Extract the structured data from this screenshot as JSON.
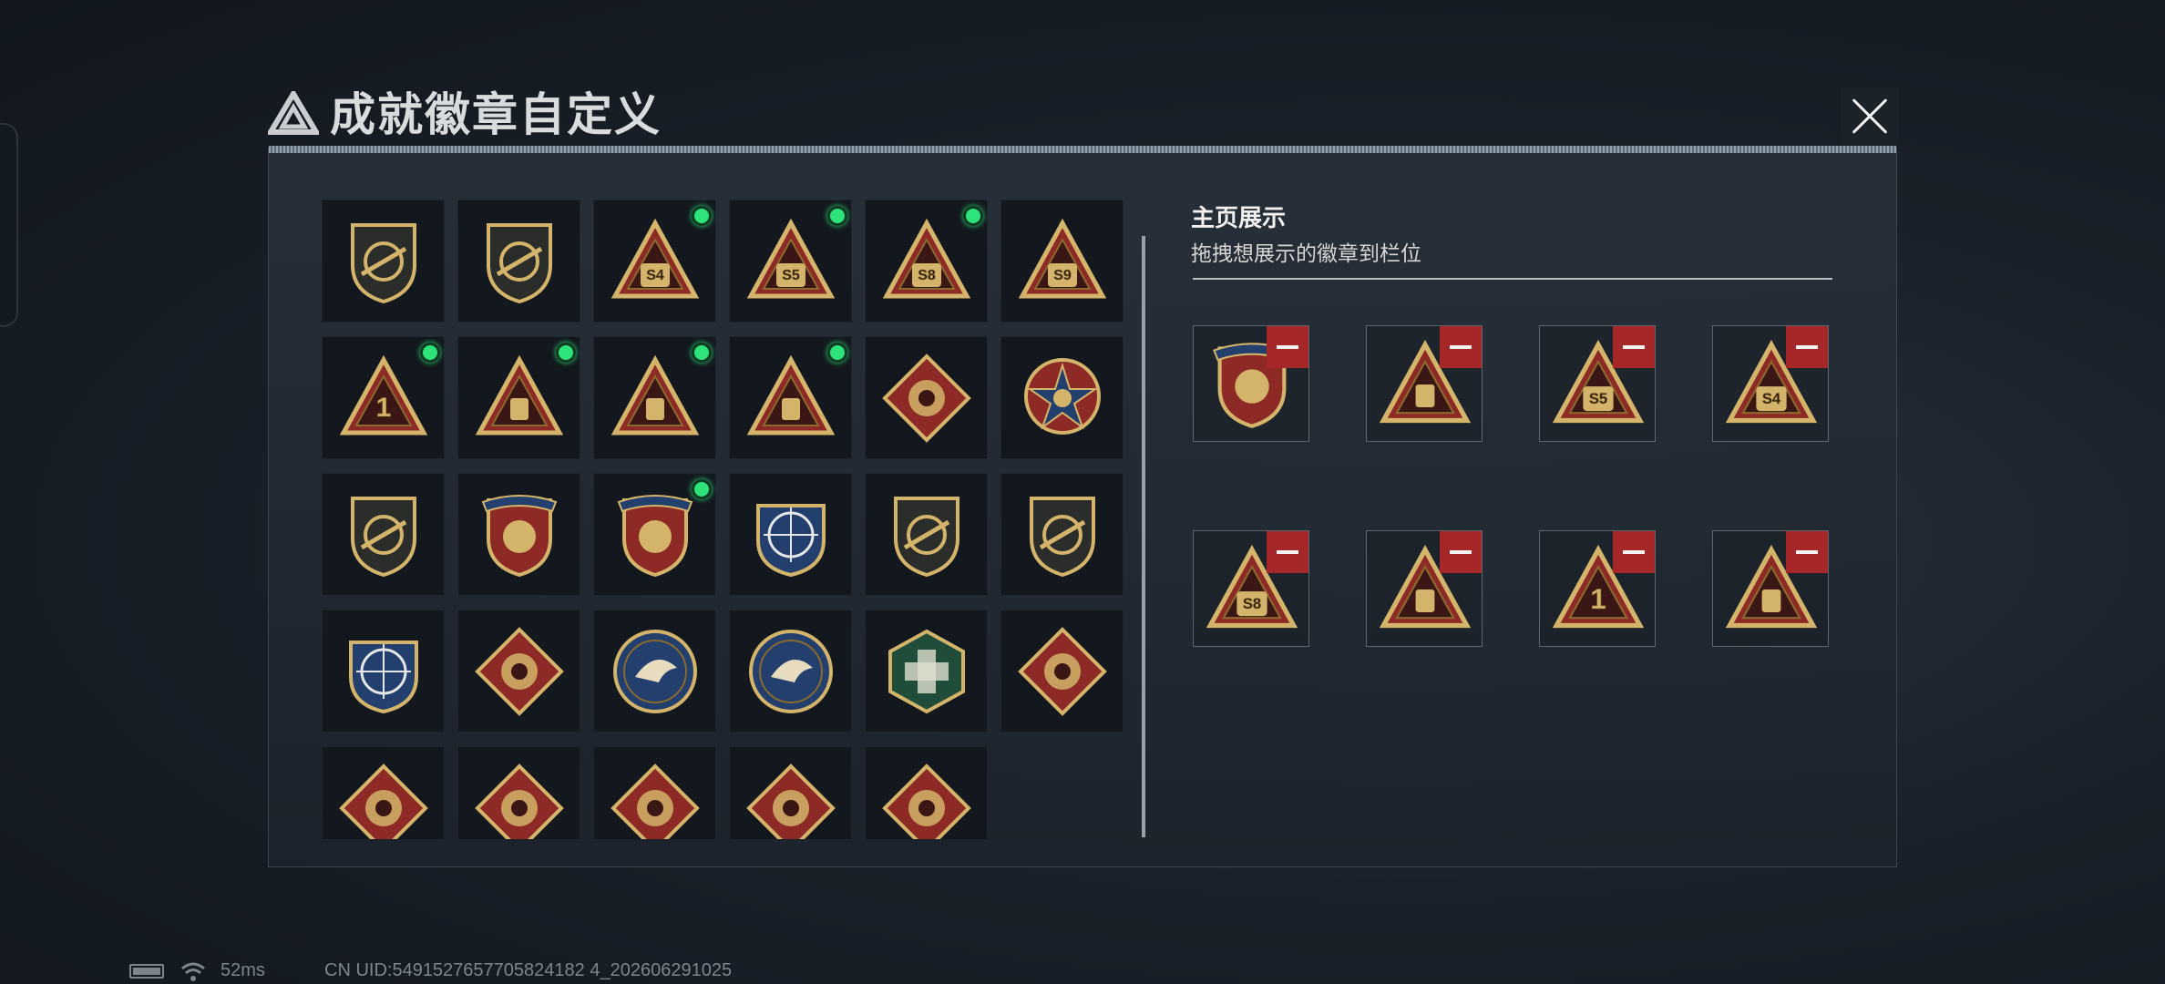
{
  "window": {
    "title": "成就徽章自定义"
  },
  "colors": {
    "gold": "#d4b46a",
    "gold_dark": "#8a6a2e",
    "red": "#8d2a25",
    "navy": "#223f6e",
    "green_dot": "#2ee37a",
    "remove_red": "#a62727"
  },
  "badge_grid": {
    "badges": [
      {
        "icon": "shield-logo-badge-icon",
        "new": false
      },
      {
        "icon": "helicopter-shield-badge-icon",
        "new": false
      },
      {
        "icon": "s4-backpack-triangle-badge-icon",
        "label": "S4",
        "new": true
      },
      {
        "icon": "s5-backpack-triangle-badge-icon",
        "label": "S5",
        "new": true
      },
      {
        "icon": "s8-case-triangle-badge-icon",
        "label": "S8",
        "new": true
      },
      {
        "icon": "s9-winged-triangle-badge-icon",
        "label": "S9",
        "new": false
      },
      {
        "icon": "number-one-triangle-badge-icon",
        "label": "1",
        "new": true
      },
      {
        "icon": "box-triangle-badge-icon",
        "new": true
      },
      {
        "icon": "hands-triangle-badge-icon",
        "new": true
      },
      {
        "icon": "soldiers-triangle-badge-icon",
        "new": true
      },
      {
        "icon": "fist-diamond-badge-icon",
        "new": false
      },
      {
        "icon": "skull-star-badge-icon",
        "new": false
      },
      {
        "icon": "wings-shield-badge-icon",
        "new": false
      },
      {
        "icon": "stars-shield-badge-icon",
        "new": false
      },
      {
        "icon": "laurel-shield-badge-icon",
        "new": true
      },
      {
        "icon": "crosshair-rifle-badge-icon",
        "new": false
      },
      {
        "icon": "rifle-shield-badge-icon",
        "new": false
      },
      {
        "icon": "sniper-shield-badge-icon",
        "new": false
      },
      {
        "icon": "scope-rifle-crest-badge-icon",
        "new": false
      },
      {
        "icon": "wolf-diamond-badge-icon",
        "new": false
      },
      {
        "icon": "eagle-roundel-badge-icon",
        "new": false
      },
      {
        "icon": "eagle-roundel-blue-badge-icon",
        "new": false
      },
      {
        "icon": "medic-pistol-badge-icon",
        "new": false
      },
      {
        "icon": "dragon-diamond-badge-icon",
        "new": false
      },
      {
        "icon": "dragon-head-diamond-badge-icon",
        "new": false
      },
      {
        "icon": "runner-diamond-badge-icon",
        "new": false
      },
      {
        "icon": "horse-diamond-badge-icon",
        "new": false
      },
      {
        "icon": "horse-head-diamond-badge-icon",
        "new": false
      },
      {
        "icon": "tools-diamond-badge-icon",
        "new": false
      }
    ]
  },
  "showcase": {
    "title": "主页展示",
    "subtitle": "拖拽想展示的徽章到栏位",
    "slots": [
      {
        "icon": "laurel-shield-badge-icon"
      },
      {
        "icon": "hands-triangle-badge-icon"
      },
      {
        "icon": "s5-backpack-triangle-badge-icon",
        "label": "S5"
      },
      {
        "icon": "s4-backpack-triangle-badge-icon",
        "label": "S4"
      },
      {
        "icon": "s8-case-triangle-badge-icon",
        "label": "S8"
      },
      {
        "icon": "box-triangle-badge-icon"
      },
      {
        "icon": "number-one-triangle-badge-icon",
        "label": "1"
      },
      {
        "icon": "soldiers-triangle-badge-icon"
      }
    ]
  },
  "status_bar": {
    "ping": "52ms",
    "uid": "CN UID:5491527657705824182 4_202606291025"
  }
}
